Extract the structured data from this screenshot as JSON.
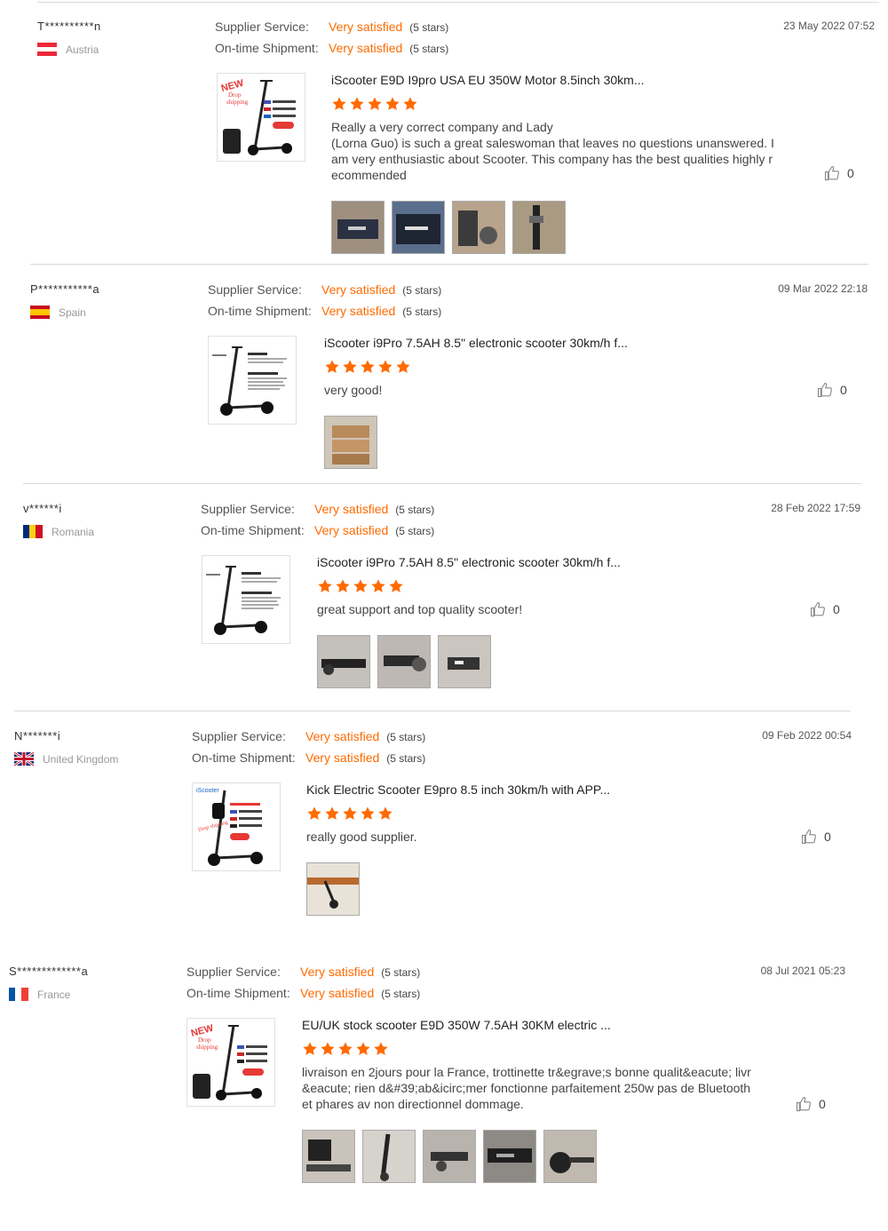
{
  "labels": {
    "supplier_service": "Supplier Service:",
    "on_time_shipment": "On-time Shipment:",
    "very_satisfied": "Very satisfied",
    "five_stars": "(5 stars)"
  },
  "colors": {
    "accent": "#ff6a00",
    "divider": "#d9d9d9"
  },
  "reviews": [
    {
      "user": "T**********n",
      "country": "Austria",
      "flag": "austria",
      "date": "23 May 2022 07:52",
      "product_title": "iScooter E9D I9pro USA EU 350W Motor 8.5inch 30km...",
      "text": "Really a very correct company and Lady\n (Lorna Guo) is such a great saleswoman that leaves no questions unanswered.  I\nam very enthusiastic about Scooter.  This company has the best qualities highly r\necommended",
      "likes": "0",
      "stars": 5
    },
    {
      "user": "P***********a",
      "country": "Spain",
      "flag": "spain",
      "date": "09 Mar 2022 22:18",
      "product_title": "iScooter i9Pro 7.5AH 8.5\" electronic scooter 30km/h f...",
      "text": "very good!",
      "likes": "0",
      "stars": 5
    },
    {
      "user": "v******i",
      "country": "Romania",
      "flag": "romania",
      "date": "28 Feb 2022 17:59",
      "product_title": "iScooter i9Pro 7.5AH 8.5\" electronic scooter 30km/h f...",
      "text": "great support and top quality scooter!",
      "likes": "0",
      "stars": 5
    },
    {
      "user": "N*******i",
      "country": "United Kingdom",
      "flag": "uk",
      "date": "09 Feb 2022 00:54",
      "product_title": "Kick Electric Scooter E9pro 8.5 inch 30km/h with APP...",
      "text": "really good supplier.",
      "likes": "0",
      "stars": 5
    },
    {
      "user": "S*************a",
      "country": "France",
      "flag": "france",
      "date": "08 Jul 2021 05:23",
      "product_title": "EU/UK stock scooter E9D 350W 7.5AH 30KM electric ...",
      "text": "livraison en 2jours pour la France, trottinette tr&egrave;s bonne qualit&eacute; livr\n&eacute; rien d&#39;ab&icirc;mer fonctionne parfaitement 250w pas de Bluetooth\net phares av non directionnel dommage.",
      "likes": "0",
      "stars": 5
    }
  ]
}
